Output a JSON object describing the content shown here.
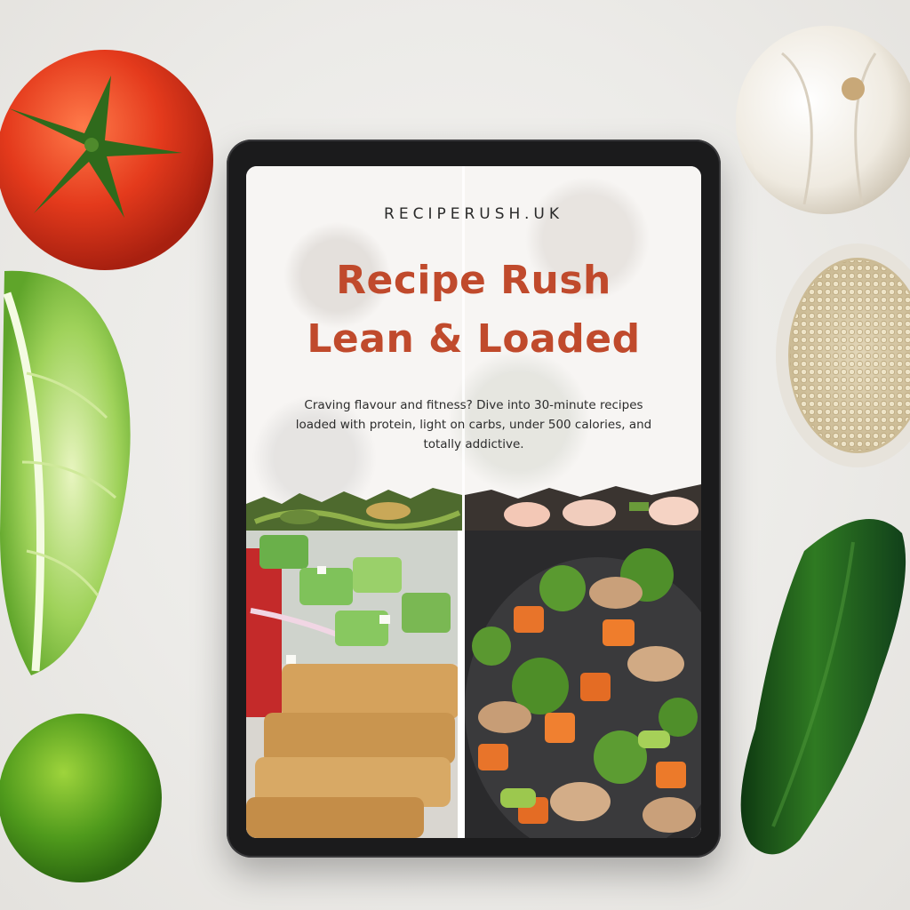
{
  "cover": {
    "site_url": "RECIPERUSH.UK",
    "title_line1": "Recipe Rush",
    "title_line2": "Lean & Loaded",
    "tagline": "Craving flavour and fitness? Dive into 30-minute recipes loaded with protein, light on carbs, under 500 calories, and totally addictive."
  },
  "colors": {
    "title": "#c04a2c",
    "background": "#ecebe8",
    "tablet_frame": "#1b1b1c"
  },
  "decor": {
    "props": [
      "tomato",
      "garlic-bulb",
      "lettuce-leaf",
      "quinoa-bowl",
      "lime",
      "cucumber"
    ],
    "photos": [
      "cucumber-salad-and-breaded-tofu",
      "chicken-broccoli-carrot-stir-fry"
    ]
  }
}
